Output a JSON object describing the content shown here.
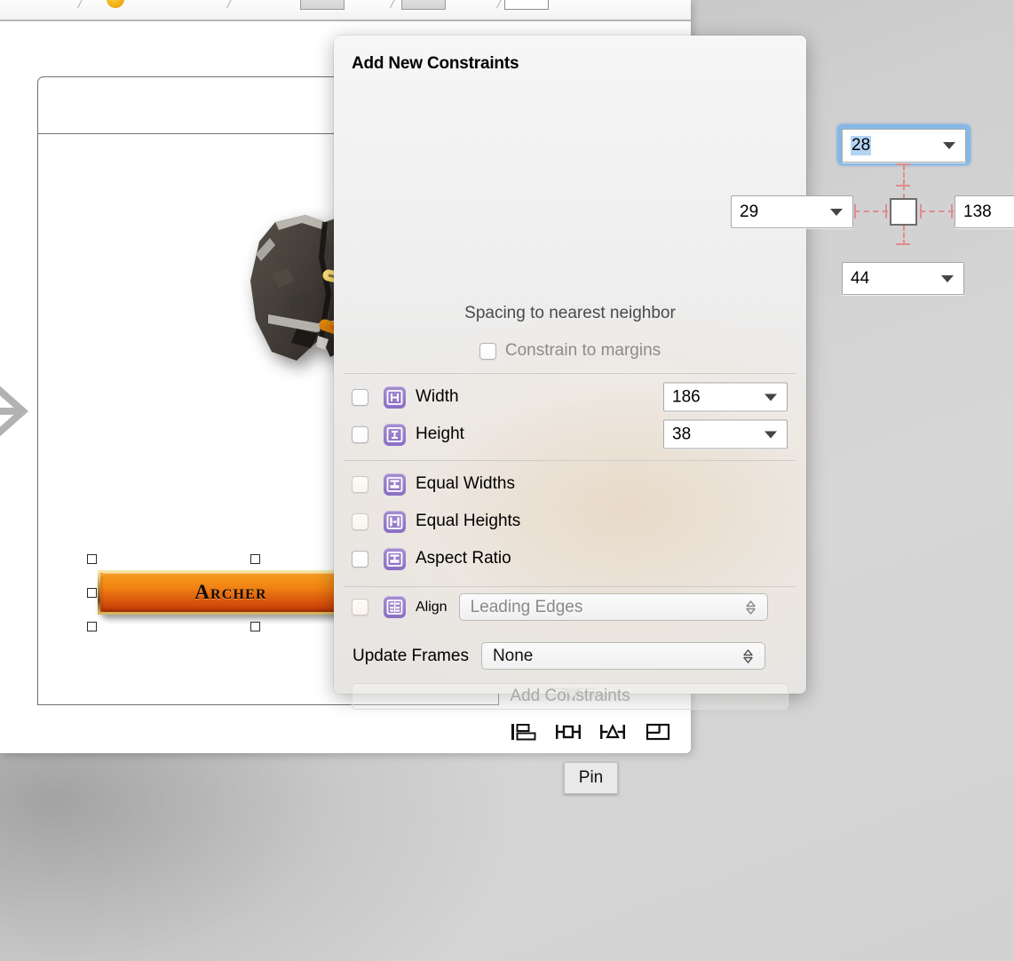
{
  "popover": {
    "title": "Add New Constraints",
    "spacing": {
      "top": {
        "value": "28",
        "name": "top-spacing"
      },
      "leading": {
        "value": "29",
        "name": "leading-spacing"
      },
      "trailing": {
        "value": "138",
        "name": "trailing-spacing"
      },
      "bottom": {
        "value": "44",
        "name": "bottom-spacing"
      },
      "caption": "Spacing to nearest neighbor"
    },
    "constrain_to_margins": {
      "label": "Constrain to margins",
      "checked": false,
      "enabled": false
    },
    "size_rows": [
      {
        "label": "Width",
        "icon": "width-icon",
        "value": "186",
        "checked": false
      },
      {
        "label": "Height",
        "icon": "height-icon",
        "value": "38",
        "checked": false
      }
    ],
    "relation_rows": [
      {
        "label": "Equal Widths",
        "icon": "equal-widths-icon",
        "checked": false
      },
      {
        "label": "Equal Heights",
        "icon": "equal-heights-icon",
        "checked": false
      },
      {
        "label": "Aspect Ratio",
        "icon": "aspect-ratio-icon",
        "checked": false
      }
    ],
    "align": {
      "label": "Align",
      "icon": "align-icon",
      "checked": false,
      "selected": "Leading Edges",
      "options": [
        "Leading Edges"
      ]
    },
    "update_frames": {
      "label": "Update Frames",
      "selected": "None",
      "options": [
        "None"
      ]
    },
    "add_constraints_button": {
      "label": "Add Constraints",
      "enabled": false
    }
  },
  "autolayout_toolbar": {
    "buttons": [
      {
        "name": "align-tool-icon",
        "title": "Align"
      },
      {
        "name": "pin-tool-icon",
        "title": "Pin"
      },
      {
        "name": "resolve-tool-icon",
        "title": "Resolve Auto Layout Issues"
      },
      {
        "name": "stack-tool-icon",
        "title": "Embed In Stack"
      }
    ],
    "active_index": 1
  },
  "tooltip": {
    "text": "Pin"
  },
  "canvas": {
    "archer_button": {
      "label": "Archer",
      "selected": true
    },
    "segue_arrow": "segue-arrow-icon",
    "rock_artwork": "rock-artwork"
  },
  "colors": {
    "accent_blue": "#86b8e6",
    "selection_blue": "#b3d4f5",
    "constraint_pink": "#e08c8c",
    "icon_purple": "#8a6fc4",
    "button_orange": "#f08213",
    "disabled_gray": "#a9a9a9"
  }
}
